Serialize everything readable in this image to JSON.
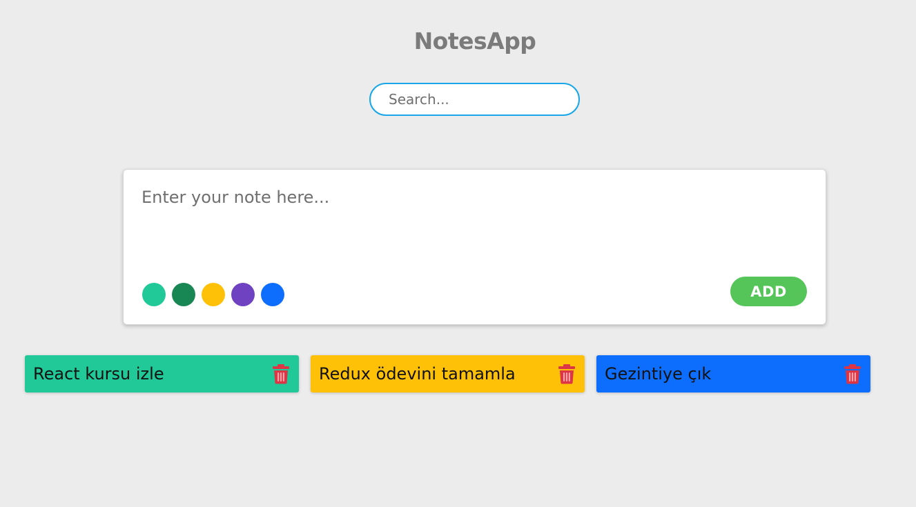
{
  "app": {
    "title": "NotesApp"
  },
  "search": {
    "placeholder": "Search...",
    "value": ""
  },
  "editor": {
    "placeholder": "Enter your note here...",
    "value": "",
    "add_label": "ADD",
    "add_color": "#55c55a",
    "color_options": [
      {
        "name": "teal",
        "hex": "#20c997"
      },
      {
        "name": "green",
        "hex": "#198754"
      },
      {
        "name": "yellow",
        "hex": "#ffc107"
      },
      {
        "name": "purple",
        "hex": "#6f42c1"
      },
      {
        "name": "blue",
        "hex": "#0d6efd"
      }
    ]
  },
  "notes": [
    {
      "text": "React kursu izle",
      "color": "#20c997",
      "icon": "trash-icon"
    },
    {
      "text": "Redux ödevini tamamla",
      "color": "#ffc107",
      "icon": "trash-icon"
    },
    {
      "text": "Gezintiye çık",
      "color": "#0d6efd",
      "icon": "trash-icon"
    }
  ],
  "theme": {
    "background": "#ececec",
    "title_color": "#7b7b7b",
    "search_border": "#17a6e6",
    "delete_icon_color": "#dc3545"
  }
}
